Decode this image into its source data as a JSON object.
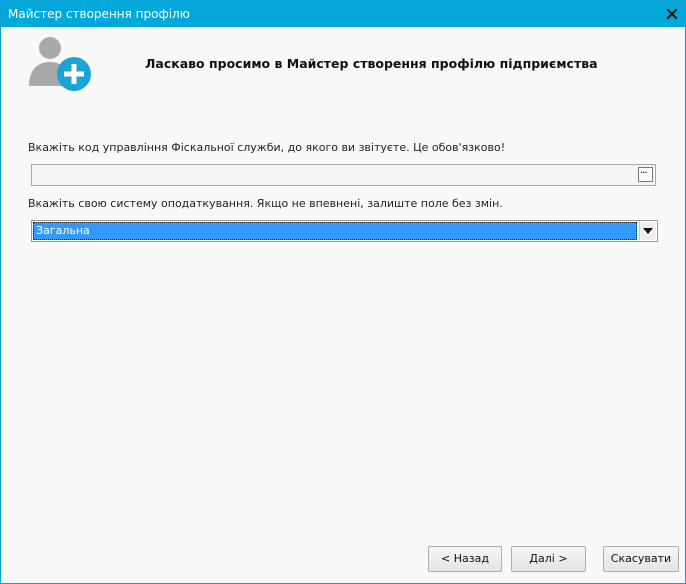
{
  "window": {
    "title": "Майстер створення профілю",
    "close_icon": "close-icon"
  },
  "header": {
    "icon": "add-user-icon",
    "welcome_text": "Ласкаво просимо в Майстер створення профілю підприємства"
  },
  "form": {
    "code_label": "Вкажіть код управління Фіскальної служби, до якого ви звітуєте. Це обов'язково!",
    "code_value": "",
    "browse_label": "...",
    "tax_label": "Вкажіть свою систему оподаткування. Якщо не впевнені, залиште поле без змін.",
    "tax_selected": "Загальна"
  },
  "buttons": {
    "back": "< Назад",
    "next": "Далі >",
    "cancel": "Скасувати"
  },
  "colors": {
    "titlebar": "#02a8da",
    "icon_accent": "#1aa3d4",
    "selection": "#3399ff"
  }
}
